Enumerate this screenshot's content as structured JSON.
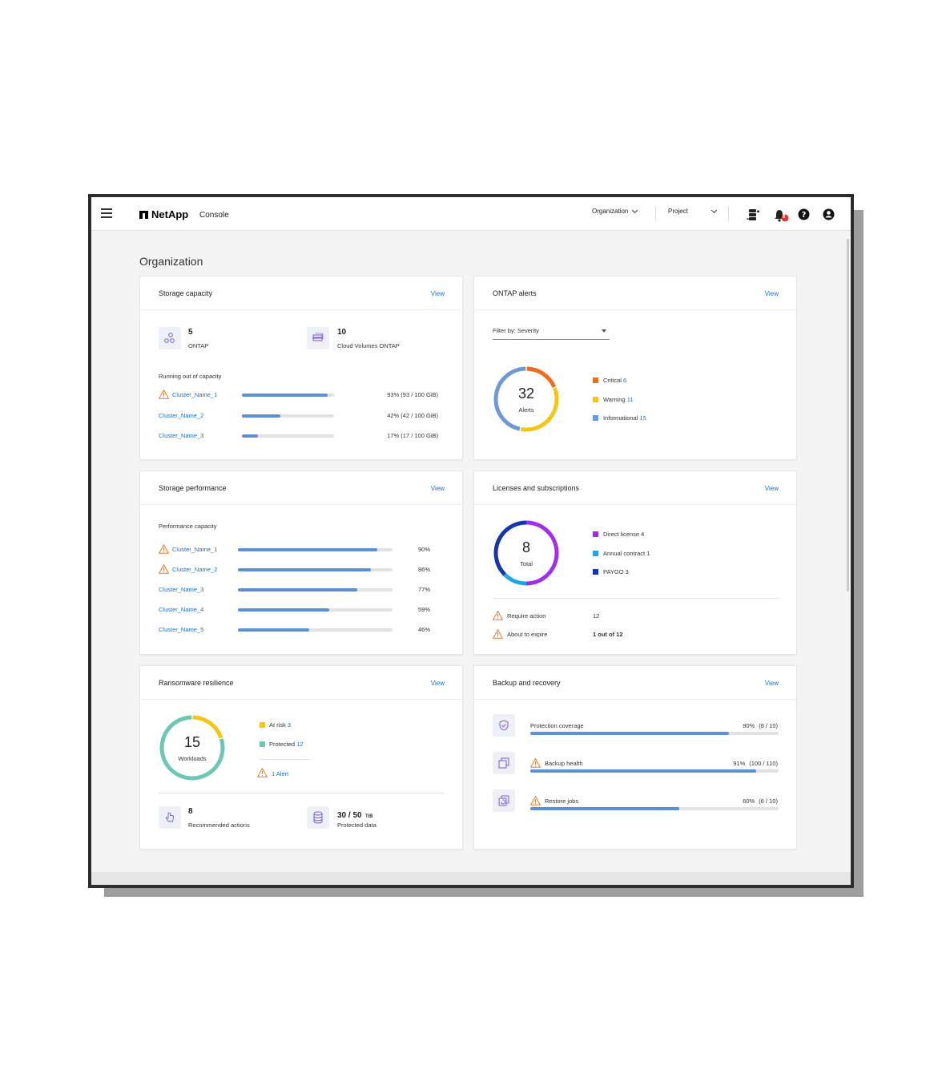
{
  "header": {
    "brand": "NetApp",
    "console": "Console",
    "organization_dd": "Organization",
    "project_dd": "Project",
    "notification_count": "8"
  },
  "page": {
    "title": "Organization"
  },
  "storage_capacity": {
    "title": "Storage capacity",
    "view": "View",
    "ontap_count": "5",
    "ontap_label": "ONTAP",
    "cvo_count": "10",
    "cvo_label": "Cloud Volumes ONTAP",
    "section": "Running out of capacity",
    "rows": [
      {
        "name": "Cluster_Name_1",
        "value": "93% (93 / 100 GiB)",
        "pct": 93,
        "warn": true
      },
      {
        "name": "Cluster_Name_2",
        "value": "42% (42 / 100 GiB)",
        "pct": 42,
        "warn": false
      },
      {
        "name": "Cluster_Name_3",
        "value": "17% (17 / 100 GiB)",
        "pct": 17,
        "warn": false
      }
    ]
  },
  "ontap_alerts": {
    "title": "ONTAP alerts",
    "view": "View",
    "filter": "Filter by: Severity",
    "total": "32",
    "total_label": "Alerts",
    "legend": [
      {
        "label": "Critical",
        "count": "6",
        "color": "#f26b1d"
      },
      {
        "label": "Warning",
        "count": "11",
        "color": "#f5c518"
      },
      {
        "label": "Informational",
        "count": "15",
        "color": "#6f98d6"
      }
    ]
  },
  "storage_performance": {
    "title": "Storage performance",
    "view": "View",
    "section": "Performance capacity",
    "rows": [
      {
        "name": "Cluster_Name_1",
        "value": "90%",
        "pct": 90,
        "warn": true
      },
      {
        "name": "Cluster_Name_2",
        "value": "86%",
        "pct": 86,
        "warn": true
      },
      {
        "name": "Cluster_Name_3",
        "value": "77%",
        "pct": 77,
        "warn": false
      },
      {
        "name": "Cluster_Name_4",
        "value": "59%",
        "pct": 59,
        "warn": false
      },
      {
        "name": "Cluster_Name_5",
        "value": "46%",
        "pct": 46,
        "warn": false
      }
    ]
  },
  "licenses": {
    "title": "Licenses and subscriptions",
    "view": "View",
    "total": "8",
    "total_label": "Total",
    "legend": [
      {
        "label": "Direct license 4",
        "count": 4,
        "color": "#a12de8"
      },
      {
        "label": "Annual contract 1",
        "count": 1,
        "color": "#1ea7e8"
      },
      {
        "label": "PAYGO 3",
        "count": 3,
        "color": "#1535a8"
      }
    ],
    "require_action_label": "Require action",
    "require_action_value": "12",
    "expire_label": "About to expire",
    "expire_value": "1 out of 12"
  },
  "ransomware": {
    "title": "Ransomware resilience",
    "view": "View",
    "total": "15",
    "total_label": "Workloads",
    "legend": [
      {
        "label": "At risk",
        "count": "3",
        "value": 3,
        "color": "#f5c518"
      },
      {
        "label": "Protected",
        "count": "12",
        "value": 12,
        "color": "#6cc8b4"
      }
    ],
    "alert": "1 Alert",
    "actions_count": "8",
    "actions_label": "Recommended actions",
    "protected_value": "30 / 50",
    "protected_unit": "TiB",
    "protected_label": "Protected data"
  },
  "backup": {
    "title": "Backup and recovery",
    "view": "View",
    "rows": [
      {
        "label": "Protection coverage",
        "pct_text": "80%",
        "detail": "(8 / 10)",
        "pct": 80,
        "warn": false
      },
      {
        "label": "Backup health",
        "pct_text": "91%",
        "detail": "(100 / 110)",
        "pct": 91,
        "warn": true
      },
      {
        "label": "Restore jobs",
        "pct_text": "60%",
        "detail": "(6 / 10)",
        "pct": 60,
        "warn": true
      }
    ]
  }
}
